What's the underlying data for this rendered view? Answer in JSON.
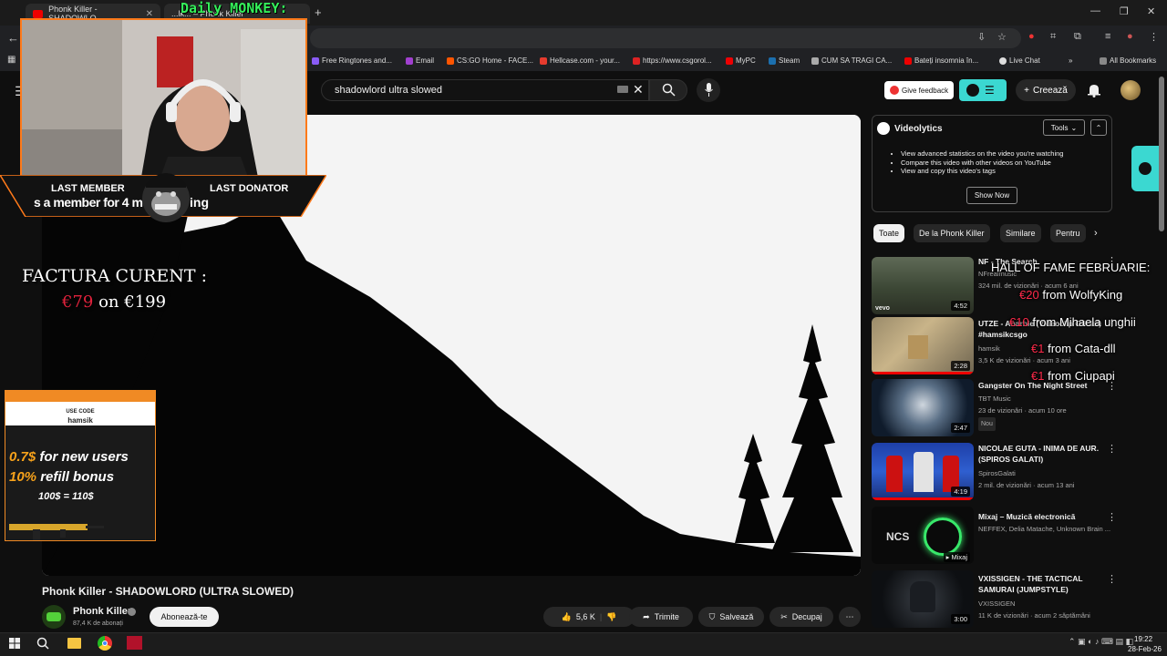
{
  "browser": {
    "tabs": [
      {
        "label": "Phonk Killer - SHADOWLO"
      },
      {
        "label": "...lk... – Phonk Killer"
      }
    ],
    "bookmarks": [
      {
        "label": "Free Ringtones and...",
        "color": "#8a5cf6"
      },
      {
        "label": "Email",
        "color": "#a040d0"
      },
      {
        "label": "CS:GO Home - FACE...",
        "color": "#ff5500"
      },
      {
        "label": "Hellcase.com - your...",
        "color": "#e63b2e"
      },
      {
        "label": "https://www.csgorol...",
        "color": "#d22"
      },
      {
        "label": "MyPC",
        "color": "#e00"
      },
      {
        "label": "Steam",
        "color": "#1b6fae"
      },
      {
        "label": "CUM SA TRAGI CA...",
        "color": "#aaa"
      },
      {
        "label": "Bateți insomnia în...",
        "color": "#e00"
      },
      {
        "label": "Live Chat",
        "color": "#ddd"
      }
    ],
    "all_bookmarks": "All Bookmarks"
  },
  "youtube": {
    "search": {
      "query": "shadowlord ultra slowed"
    },
    "header": {
      "give_feedback": "Give feedback",
      "create": "Creează"
    },
    "video": {
      "title": "Phonk Killer - SHADOWLORD (ULTRA SLOWED)",
      "channel": "Phonk Killer",
      "subscribers": "87,4 K de abonați",
      "subscribe": "Abonează-te",
      "likes": "5,6 K",
      "share": "Trimite",
      "save": "Salvează",
      "clip": "Decupaj"
    },
    "videolytics": {
      "title": "Videolytics",
      "tools": "Tools",
      "bullets": [
        "View advanced statistics on the video you're watching",
        "Compare this video with other videos on YouTube",
        "View and copy this video's tags"
      ],
      "show_now": "Show Now"
    },
    "chips": [
      "Toate",
      "De la Phonk Killer",
      "Similare",
      "Pentru"
    ],
    "recommendations": [
      {
        "title": "NF - The Search",
        "channel": "NFrealmusic",
        "meta": "324 mil. de vizionări · acum 6 ani",
        "duration": "4:52"
      },
      {
        "title": "UTZE - Anarhie (Videoclip Oficial) #hamsikcsgo",
        "channel": "hamsik",
        "meta": "3,5 K de vizionări · acum 3 ani",
        "duration": "2:28"
      },
      {
        "title": "Gangster On The Night Street",
        "channel": "TBT Music",
        "meta": "23 de vizionări · acum 10 ore",
        "duration": "2:47",
        "badge": "Nou"
      },
      {
        "title": "NICOLAE GUTA - INIMA DE AUR. (SPIROS GALATI)",
        "channel": "SpirosGalati",
        "meta": "2 mil. de vizionări · acum 13 ani",
        "duration": "4:19"
      },
      {
        "title": "Mixaj – Muzică electronică",
        "channel": "NEFFEX, Delia Matache, Unknown Brain ...",
        "meta": "",
        "duration": "Mixaj"
      },
      {
        "title": "VXISSIGEN - THE TACTICAL SAMURAI (JUMPSTYLE)",
        "channel": "VXISSIGEN",
        "meta": "11 K de vizionări · acum 2 săptămâni",
        "duration": "3:00"
      }
    ]
  },
  "stream_overlay": {
    "title": "Daily MONKEY:",
    "last_member_label": "LAST MEMBER",
    "last_member_text": "s a member for 4 m",
    "last_donator_label": "LAST DONATOR",
    "last_donator_text": "ing",
    "factura_label": "FACTURA CURENT :",
    "factura_current": "€79",
    "factura_on": "on",
    "factura_total": "€199",
    "promo": {
      "use_code_label": "USE CODE",
      "code": "hamsik",
      "line1_amount": "0.7$",
      "line1_text": " for new users",
      "line2_amount": "10%",
      "line2_text": " refill bonus",
      "line3": "100$ = 110$"
    },
    "hall_of_fame": {
      "title": "HALL OF FAME FEBRUARIE:",
      "entries": [
        {
          "amount": "€20",
          "name": "from WolfyKing"
        },
        {
          "amount": "€10",
          "name": "from Mihaela unghii"
        },
        {
          "amount": "€1",
          "name": "from Cata-dll"
        },
        {
          "amount": "€1",
          "name": "from Ciupapi"
        }
      ]
    }
  },
  "taskbar": {
    "time": "19:22",
    "date": "28-Feb-26"
  }
}
